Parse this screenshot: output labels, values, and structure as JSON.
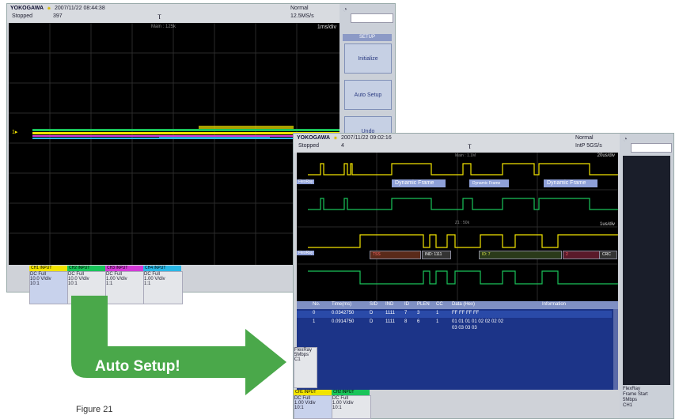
{
  "colors": {
    "ch1": "#f2e400",
    "ch2": "#19c45a",
    "ch3": "#d33ad6",
    "ch4": "#2ab7e6",
    "accent_blue": "#1c3488",
    "arrow_green": "#4aa84a"
  },
  "screen1": {
    "brand": "YOKOGAWA",
    "datetime": "2007/11/22 08:44:38",
    "status": "Stopped",
    "count": "397",
    "mode": "Normal",
    "rate": "12.5MS/s",
    "timebase": "1ms/div",
    "main_label": "Main : 125k",
    "setup_title": "SETUP",
    "buttons": [
      "Initialize",
      "Auto Setup",
      "Undo"
    ],
    "channels": [
      {
        "tab": "CH1 INPUT",
        "coupling": "DC Full",
        "vdiv": "10.0 V/div",
        "probe": "10:1"
      },
      {
        "tab": "CH2 INPUT",
        "coupling": "DC Full",
        "vdiv": "10.0 V/div",
        "probe": "10:1"
      },
      {
        "tab": "CH3 INPUT",
        "coupling": "DC Full",
        "vdiv": "1.00 V/div",
        "probe": "1:1"
      },
      {
        "tab": "CH4 INPUT",
        "coupling": "DC Full",
        "vdiv": "1.00 V/div",
        "probe": "1:1"
      }
    ]
  },
  "screen2": {
    "brand": "YOKOGAWA",
    "datetime": "2007/11/22 09:02:16",
    "status": "Stopped",
    "count": "4",
    "mode": "Normal",
    "rate": "IntP 5GS/s",
    "timebase_top": "20us/div",
    "timebase_zoom": "1us/div",
    "main_label": "Main : 1.1M",
    "zoom_label": "Z1 : 50k",
    "bus_label": "FlexRay",
    "frames": [
      "Dynamic Frame",
      "Dynamic Frame",
      "Dynamic Frame"
    ],
    "fields": [
      "TSS",
      "IND: 1111",
      "ID: 7",
      "2",
      "CRC"
    ],
    "table": {
      "headers": [
        "No.",
        "Time(ms)",
        "S/D",
        "IND",
        "ID",
        "PLEN",
        "CC",
        "Data (Hex)",
        "Information"
      ],
      "rows": [
        {
          "no": "0",
          "time": "0.0342750",
          "sd": "D",
          "ind": "1111",
          "id": "7",
          "plen": "3",
          "cc": "1",
          "data": "FF FF FF FF",
          "data2": ""
        },
        {
          "no": "1",
          "time": "0.0914750",
          "sd": "D",
          "ind": "1111",
          "id": "8",
          "plen": "6",
          "cc": "1",
          "data": "01 01 01 01 02 02 02 02",
          "data2": "03 03 03 03"
        }
      ]
    },
    "info_left": [
      "FlexRay",
      "5Mbps",
      "C1"
    ],
    "info_right": [
      "FlexRay",
      "Frame Start",
      "5Mbps",
      "CH1"
    ],
    "channels": [
      {
        "tab": "CH1 INPUT",
        "coupling": "DC Full",
        "vdiv": "1.00 V/div",
        "probe": "10:1"
      },
      {
        "tab": "CH2 INPUT",
        "coupling": "DC Full",
        "vdiv": "1.00 V/div",
        "probe": "10:1"
      }
    ]
  },
  "arrow_text": "Auto Setup!",
  "caption": "Figure 21"
}
